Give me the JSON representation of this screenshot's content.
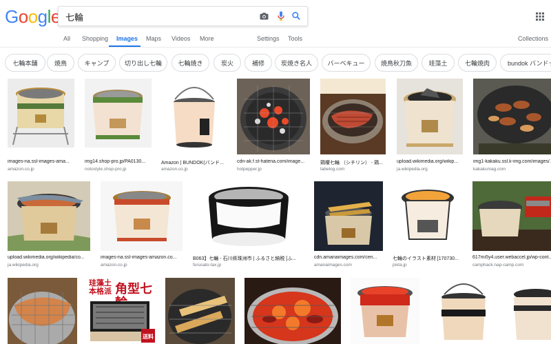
{
  "logo": {
    "g1": "G",
    "o1": "o",
    "o2": "o",
    "g2": "g",
    "l": "l",
    "e": "e"
  },
  "search": {
    "query": "七輪"
  },
  "icons": {
    "camera": "camera-icon",
    "mic": "microphone-icon",
    "search": "search-icon",
    "apps": "apps-grid-icon"
  },
  "tabs": {
    "all": "All",
    "shopping": "Shopping",
    "images": "Images",
    "maps": "Maps",
    "videos": "Videos",
    "more": "More",
    "settings": "Settings",
    "tools": "Tools",
    "collections": "Collections"
  },
  "chips": [
    "七輪本舗",
    "焼鳥",
    "キャンプ",
    "切り出し七輪",
    "七輪焼き",
    "炭火",
    "補修",
    "炭焼き名人",
    "バーベキュー",
    "焼鳥秋刀魚",
    "珪藻土",
    "七輪焼肉",
    "bundok バンドック"
  ],
  "results": [
    [
      {
        "title": "images-na.ssl-images-ama...",
        "source": "amazon.co.jp"
      },
      {
        "title": "img14.shop-pro.jp/PA0130...",
        "source": "notostyle.shop-pro.jp"
      },
      {
        "title": "Amazon | BUNDOK(バンド...",
        "source": "amazon.co.jp"
      },
      {
        "title": "cdn-ak.f.st-hatena.com/image...",
        "source": "hotpepper.jp"
      },
      {
        "title": "鶏權七輪 （シチリン） - 鶏...",
        "source": "tabelog.com"
      },
      {
        "title": "upload.wikimedia.org/wikip...",
        "source": "ja.wikipedia.org"
      },
      {
        "title": "img1-kakaku.ssl.k-img.com/images/...",
        "source": "kakakumag.com"
      }
    ],
    [
      {
        "title": "upload.wikimedia.org/wikipedia/co...",
        "source": "ja.wikipedia.org"
      },
      {
        "title": "images-na.ssl-images-amazon.co...",
        "source": "amazon.co.jp"
      },
      {
        "title": "B063】七輪 - 石川県珠洲市 | ふるさと納税 [ふ...",
        "source": "furusato-tax.jp"
      },
      {
        "title": "cdn.amanaimages.com/cen...",
        "source": "amanaimages.com"
      },
      {
        "title": "七輪のイラスト素材 [170730...",
        "source": "pixta.jp"
      },
      {
        "title": "617mi5y4.user.webaccel.jp/wp-cont...",
        "source": "camphack.nap-camp.com"
      }
    ],
    [
      {
        "title": "",
        "source": ""
      },
      {
        "title": "",
        "source": ""
      },
      {
        "title": "",
        "source": ""
      },
      {
        "title": "",
        "source": ""
      },
      {
        "title": "",
        "source": ""
      },
      {
        "title": "",
        "source": ""
      },
      {
        "title": "",
        "source": ""
      }
    ]
  ],
  "overlay_texts": {
    "box_line1": "珪藻土",
    "box_line2": "本格派",
    "box_big": "角型七輪",
    "box_tag": "送料"
  },
  "colors": {
    "accent": "#1a73e8",
    "chip_border": "#dadce0",
    "tab_text": "#5f6368",
    "caption_source": "#70757a"
  }
}
